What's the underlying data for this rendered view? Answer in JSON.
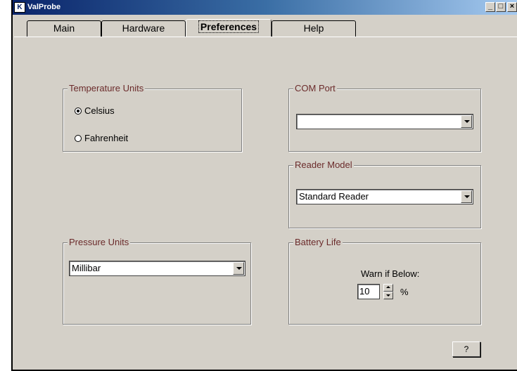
{
  "window": {
    "title": "ValProbe",
    "icon_letter": "K"
  },
  "window_controls": {
    "minimize": "_",
    "maximize": "□",
    "close": "×"
  },
  "tabs": [
    {
      "label": "Main"
    },
    {
      "label": "Hardware"
    },
    {
      "label": "Preferences",
      "active": true
    },
    {
      "label": "Help"
    }
  ],
  "temperature": {
    "label": "Temperature Units",
    "options": [
      {
        "label": "Celsius",
        "checked": true
      },
      {
        "label": "Fahrenheit",
        "checked": false
      }
    ]
  },
  "com_port": {
    "label": "COM Port",
    "value": ""
  },
  "reader_model": {
    "label": "Reader Model",
    "value": "Standard Reader"
  },
  "pressure": {
    "label": "Pressure Units",
    "value": "Millibar"
  },
  "battery": {
    "label": "Battery Life",
    "warn_label": "Warn if Below:",
    "value": "10",
    "unit": "%"
  },
  "help_button": {
    "label": "?"
  },
  "colors": {
    "group_label": "#6b2b2b",
    "face": "#d4d0c8",
    "title_start": "#0a246a",
    "title_end": "#a6caf0"
  }
}
